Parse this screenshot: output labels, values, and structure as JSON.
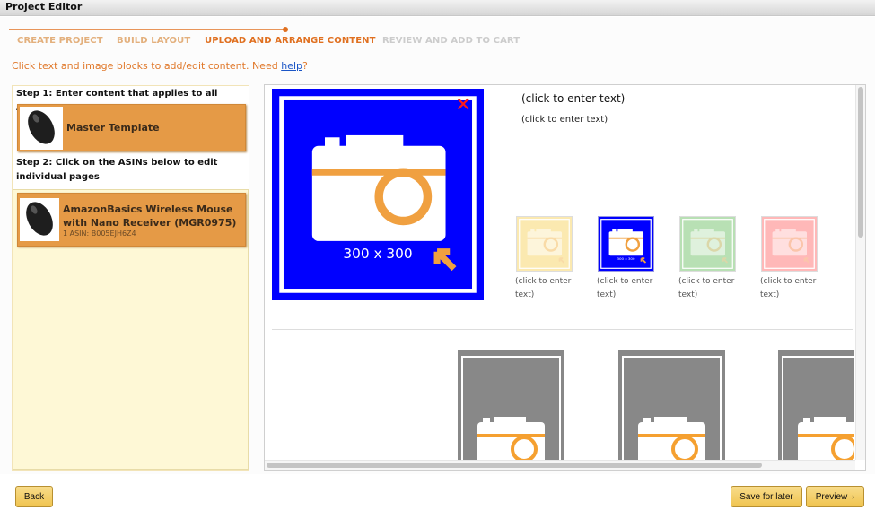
{
  "window": {
    "title": "Project Editor"
  },
  "steps": [
    {
      "label": "CREATE PROJECT",
      "state": "done"
    },
    {
      "label": "BUILD LAYOUT",
      "state": "done"
    },
    {
      "label": "UPLOAD AND ARRANGE CONTENT",
      "state": "current"
    },
    {
      "label": "REVIEW AND ADD TO CART",
      "state": "upcoming"
    }
  ],
  "instruction": {
    "text": "Click text and image blocks to add/edit content. Need ",
    "link": "help",
    "suffix": "?"
  },
  "sidebar": {
    "step1": "Step 1: Enter content that applies to all ASINs",
    "master": {
      "label": "Master Template"
    },
    "step2": "Step 2: Click on the ASINs below to edit individual pages",
    "items": [
      {
        "title": "AmazonBasics Wireless Mouse with Nano Receiver (MGR0975)",
        "sub": "1 ASIN: B005EJH6Z4"
      }
    ]
  },
  "editor": {
    "main_image": {
      "size_label": "300 x 300",
      "color": "#0000ff"
    },
    "heading_text": "(click to enter text)",
    "body_text": "(click to enter text)",
    "thumbnails": [
      {
        "color": "#fbe9b0",
        "caption": "(click to enter text)",
        "selected": false
      },
      {
        "color": "#0000ff",
        "caption": "(click to enter text)",
        "selected": true
      },
      {
        "color": "#b8e0b4",
        "caption": "(click to enter text)",
        "selected": false
      },
      {
        "color": "#ffb8b8",
        "caption": "(click to enter text)",
        "selected": false
      }
    ],
    "thumb_size_label": "300 x 300"
  },
  "buttons": {
    "back": "Back",
    "save": "Save for later",
    "preview": "Preview",
    "preview_icon": "chevron-right-icon"
  },
  "colors": {
    "accent": "#e0782a",
    "card": "#e59a46",
    "button": "#f0c450"
  }
}
